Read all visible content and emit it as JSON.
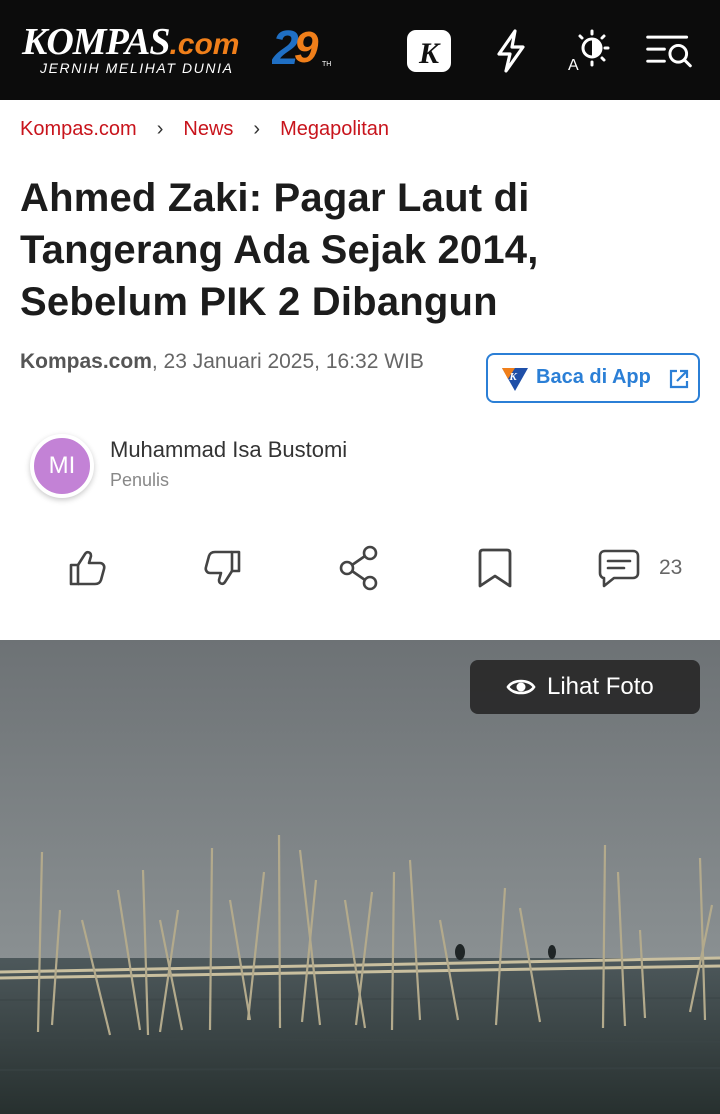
{
  "header": {
    "logo_text": "KOMPAS",
    "logo_suffix": ".com",
    "logo_tagline": "JERNIH MELIHAT DUNIA",
    "anniversary": "29",
    "anniversary_sup": "TH",
    "icons": [
      "k-app-icon",
      "lightning-icon",
      "contrast-icon",
      "menu-search-icon"
    ]
  },
  "breadcrumb": {
    "items": [
      "Kompas.com",
      "News",
      "Megapolitan"
    ],
    "separator": "›"
  },
  "article": {
    "title": "Ahmed Zaki: Pagar Laut di Tangerang Ada Sejak 2014, Sebelum PIK 2 Dibangun",
    "source": "Kompas.com",
    "datetime": ", 23 Januari 2025, 16:32 WIB",
    "app_button_label": "Baca di App",
    "author": {
      "initials": "MI",
      "name": "Muhammad Isa Bustomi",
      "role": "Penulis"
    },
    "comment_count": "23",
    "photo_button_label": "Lihat Foto"
  },
  "colors": {
    "header_bg": "#0c0c0c",
    "brand_red": "#c8141c",
    "accent_blue": "#2b7fd6",
    "avatar": "#c382d6"
  }
}
